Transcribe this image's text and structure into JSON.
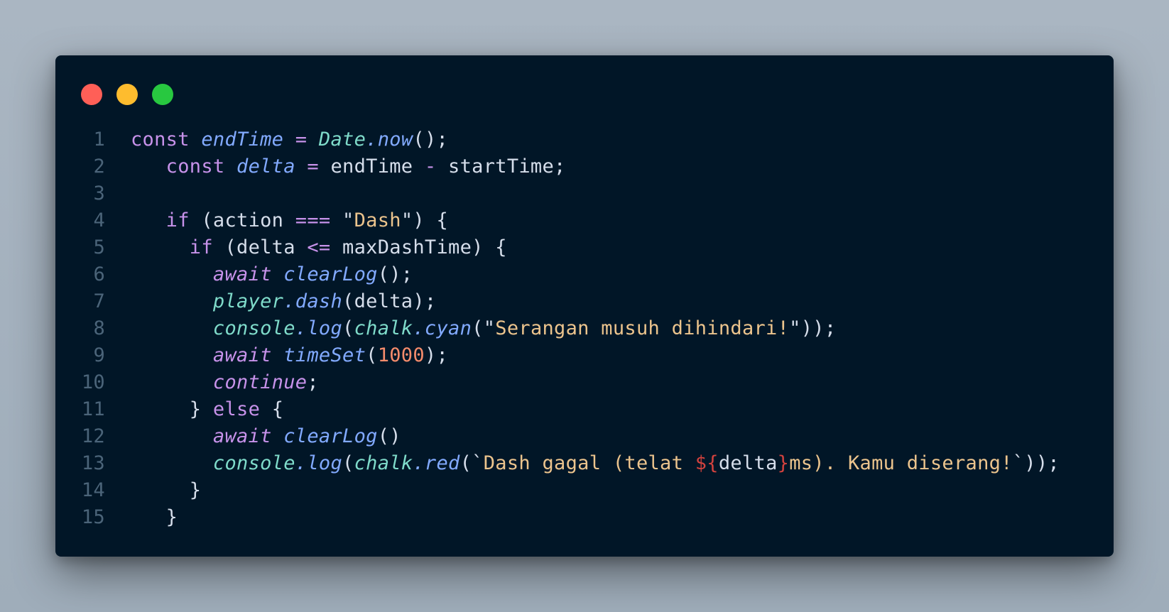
{
  "window": {
    "controls": [
      {
        "name": "close",
        "color": "#ff5f57"
      },
      {
        "name": "minimize",
        "color": "#febc2e"
      },
      {
        "name": "maximize",
        "color": "#28c840"
      }
    ]
  },
  "theme": {
    "background": "#011627",
    "line_number": "#4b6479",
    "default": "#d6deeb",
    "keyword": "#c792ea",
    "variable": "#82aaff",
    "class": "#7fdbca",
    "operator": "#c792ea",
    "string": "#ecc48d",
    "number": "#f78c6c",
    "interpolation": "#d3423e"
  },
  "lines": [
    {
      "n": "1",
      "indent": "",
      "tokens": [
        {
          "t": "const ",
          "k": "keyword"
        },
        {
          "t": "endTime",
          "k": "variable",
          "i": true
        },
        {
          "t": " ",
          "k": "default"
        },
        {
          "t": "=",
          "k": "operator"
        },
        {
          "t": " ",
          "k": "default"
        },
        {
          "t": "Date",
          "k": "class",
          "i": true
        },
        {
          "t": ".",
          "k": "variable",
          "i": true
        },
        {
          "t": "now",
          "k": "variable",
          "i": true
        },
        {
          "t": "();",
          "k": "default"
        }
      ]
    },
    {
      "n": "2",
      "indent": "   ",
      "tokens": [
        {
          "t": "const ",
          "k": "keyword"
        },
        {
          "t": "delta",
          "k": "variable",
          "i": true
        },
        {
          "t": " ",
          "k": "default"
        },
        {
          "t": "=",
          "k": "operator"
        },
        {
          "t": " endTime ",
          "k": "default"
        },
        {
          "t": "-",
          "k": "operator"
        },
        {
          "t": " startTime;",
          "k": "default"
        }
      ]
    },
    {
      "n": "3",
      "indent": "",
      "tokens": []
    },
    {
      "n": "4",
      "indent": "   ",
      "tokens": [
        {
          "t": "if",
          "k": "keyword"
        },
        {
          "t": " (action ",
          "k": "default"
        },
        {
          "t": "===",
          "k": "operator"
        },
        {
          "t": " ",
          "k": "default"
        },
        {
          "t": "\"",
          "k": "default"
        },
        {
          "t": "Dash",
          "k": "string"
        },
        {
          "t": "\"",
          "k": "default"
        },
        {
          "t": ") {",
          "k": "default"
        }
      ]
    },
    {
      "n": "5",
      "indent": "     ",
      "tokens": [
        {
          "t": "if",
          "k": "keyword"
        },
        {
          "t": " (delta ",
          "k": "default"
        },
        {
          "t": "<=",
          "k": "operator"
        },
        {
          "t": " maxDashTime) {",
          "k": "default"
        }
      ]
    },
    {
      "n": "6",
      "indent": "       ",
      "tokens": [
        {
          "t": "await",
          "k": "keyword",
          "i": true
        },
        {
          "t": " ",
          "k": "default"
        },
        {
          "t": "clearLog",
          "k": "variable",
          "i": true
        },
        {
          "t": "();",
          "k": "default"
        }
      ]
    },
    {
      "n": "7",
      "indent": "       ",
      "tokens": [
        {
          "t": "player",
          "k": "class",
          "i": true
        },
        {
          "t": ".",
          "k": "variable",
          "i": true
        },
        {
          "t": "dash",
          "k": "variable",
          "i": true
        },
        {
          "t": "(delta);",
          "k": "default"
        }
      ]
    },
    {
      "n": "8",
      "indent": "       ",
      "tokens": [
        {
          "t": "console",
          "k": "class",
          "i": true
        },
        {
          "t": ".",
          "k": "variable",
          "i": true
        },
        {
          "t": "log",
          "k": "variable",
          "i": true
        },
        {
          "t": "(",
          "k": "default"
        },
        {
          "t": "chalk",
          "k": "class",
          "i": true
        },
        {
          "t": ".",
          "k": "variable",
          "i": true
        },
        {
          "t": "cyan",
          "k": "variable",
          "i": true
        },
        {
          "t": "(\"",
          "k": "default"
        },
        {
          "t": "Serangan musuh dihindari!",
          "k": "string"
        },
        {
          "t": "\"));",
          "k": "default"
        }
      ]
    },
    {
      "n": "9",
      "indent": "       ",
      "tokens": [
        {
          "t": "await",
          "k": "keyword",
          "i": true
        },
        {
          "t": " ",
          "k": "default"
        },
        {
          "t": "timeSet",
          "k": "variable",
          "i": true
        },
        {
          "t": "(",
          "k": "default"
        },
        {
          "t": "1000",
          "k": "number"
        },
        {
          "t": ");",
          "k": "default"
        }
      ]
    },
    {
      "n": "10",
      "indent": "       ",
      "tokens": [
        {
          "t": "continue",
          "k": "keyword",
          "i": true
        },
        {
          "t": ";",
          "k": "default"
        }
      ]
    },
    {
      "n": "11",
      "indent": "     ",
      "tokens": [
        {
          "t": "} ",
          "k": "default"
        },
        {
          "t": "else",
          "k": "keyword"
        },
        {
          "t": " {",
          "k": "default"
        }
      ]
    },
    {
      "n": "12",
      "indent": "       ",
      "tokens": [
        {
          "t": "await",
          "k": "keyword",
          "i": true
        },
        {
          "t": " ",
          "k": "default"
        },
        {
          "t": "clearLog",
          "k": "variable",
          "i": true
        },
        {
          "t": "()",
          "k": "default"
        }
      ]
    },
    {
      "n": "13",
      "indent": "       ",
      "tokens": [
        {
          "t": "console",
          "k": "class",
          "i": true
        },
        {
          "t": ".",
          "k": "variable",
          "i": true
        },
        {
          "t": "log",
          "k": "variable",
          "i": true
        },
        {
          "t": "(",
          "k": "default"
        },
        {
          "t": "chalk",
          "k": "class",
          "i": true
        },
        {
          "t": ".",
          "k": "variable",
          "i": true
        },
        {
          "t": "red",
          "k": "variable",
          "i": true
        },
        {
          "t": "(`",
          "k": "default"
        },
        {
          "t": "Dash gagal (telat ",
          "k": "string"
        },
        {
          "t": "${",
          "k": "interpolation"
        },
        {
          "t": "delta",
          "k": "default"
        },
        {
          "t": "}",
          "k": "interpolation"
        },
        {
          "t": "ms). Kamu diserang!",
          "k": "string"
        },
        {
          "t": "`));",
          "k": "default"
        }
      ]
    },
    {
      "n": "14",
      "indent": "     ",
      "tokens": [
        {
          "t": "}",
          "k": "default"
        }
      ]
    },
    {
      "n": "15",
      "indent": "   ",
      "tokens": [
        {
          "t": "}",
          "k": "default"
        }
      ]
    }
  ]
}
